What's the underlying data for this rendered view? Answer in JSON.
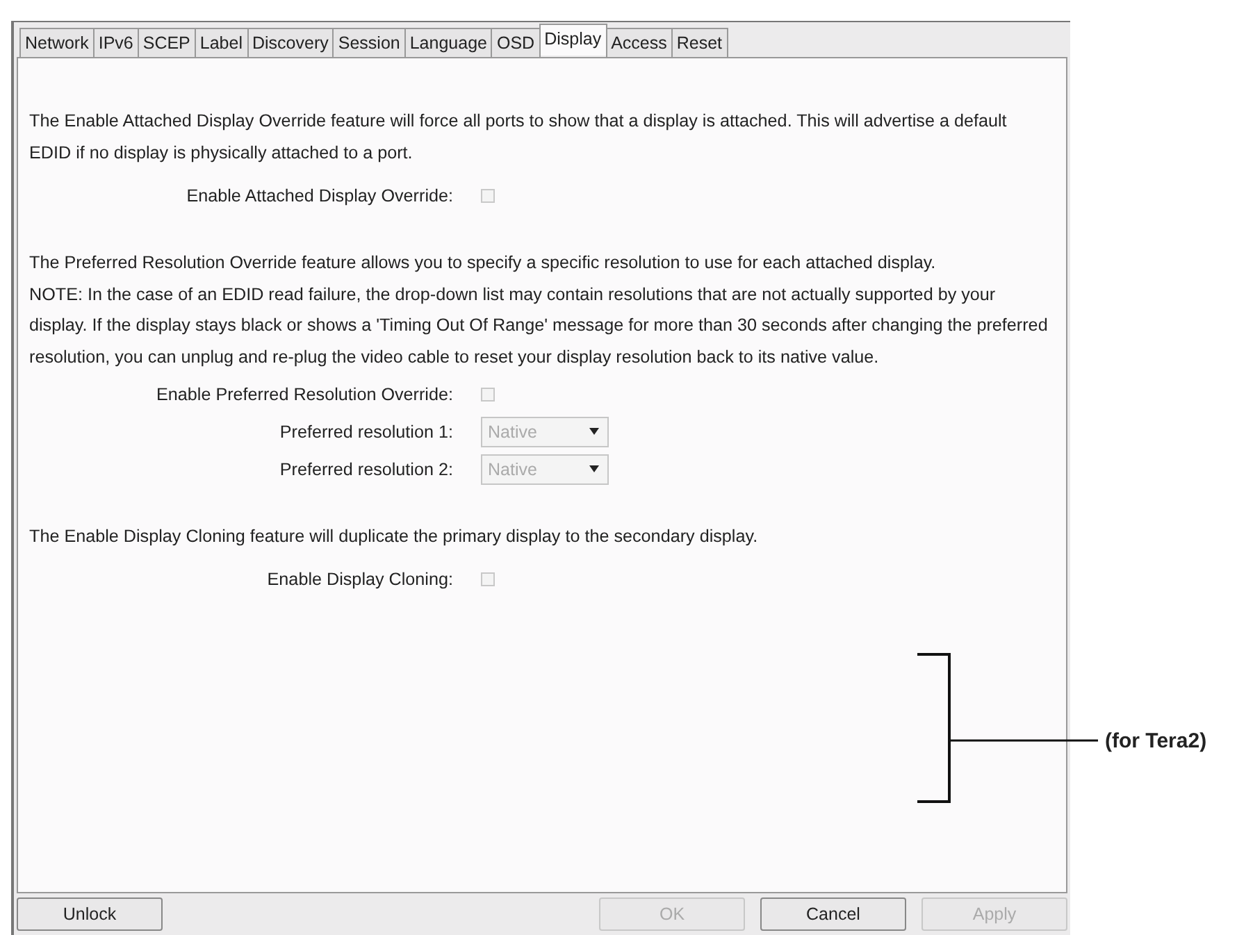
{
  "tabs": [
    {
      "label": "Network",
      "selected": false
    },
    {
      "label": "IPv6",
      "selected": false
    },
    {
      "label": "SCEP",
      "selected": false
    },
    {
      "label": "Label",
      "selected": false
    },
    {
      "label": "Discovery",
      "selected": false
    },
    {
      "label": "Session",
      "selected": false
    },
    {
      "label": "Language",
      "selected": false
    },
    {
      "label": "OSD",
      "selected": false
    },
    {
      "label": "Display",
      "selected": true
    },
    {
      "label": "Access",
      "selected": false
    },
    {
      "label": "Reset",
      "selected": false
    }
  ],
  "sections": [
    {
      "paragraphs": [
        "The Enable Attached Display Override feature will force all ports to show that a display is attached. This will advertise a default EDID if no display is physically attached to a port."
      ],
      "settings": [
        {
          "kind": "checkbox",
          "label": "Enable Attached Display Override:",
          "checked": false,
          "disabled": true
        }
      ]
    },
    {
      "paragraphs": [
        "The Preferred Resolution Override feature allows you to specify a specific resolution to use for each attached display.",
        "NOTE: In the case of an EDID read failure, the drop-down list may contain resolutions that are not actually supported by your display. If the display stays black or shows a 'Timing Out Of Range' message for more than 30 seconds after changing the preferred resolution, you can unplug and re-plug the video cable to reset your display resolution back to its native value."
      ],
      "settings": [
        {
          "kind": "checkbox",
          "label": "Enable Preferred Resolution Override:",
          "checked": false,
          "disabled": true
        },
        {
          "kind": "select",
          "label": "Preferred resolution 1:",
          "value": "Native",
          "disabled": true
        },
        {
          "kind": "select",
          "label": "Preferred resolution 2:",
          "value": "Native",
          "disabled": true
        }
      ]
    },
    {
      "paragraphs": [
        "The Enable Display Cloning feature will duplicate the primary display to the secondary display."
      ],
      "settings": [
        {
          "kind": "checkbox",
          "label": "Enable Display Cloning:",
          "checked": false,
          "disabled": true
        }
      ]
    }
  ],
  "buttons": [
    {
      "label": "Unlock",
      "disabled": false
    },
    {
      "label": "OK",
      "disabled": true
    },
    {
      "label": "Cancel",
      "disabled": false
    },
    {
      "label": "Apply",
      "disabled": true
    }
  ],
  "annotation": {
    "label": "(for Tera2)"
  }
}
